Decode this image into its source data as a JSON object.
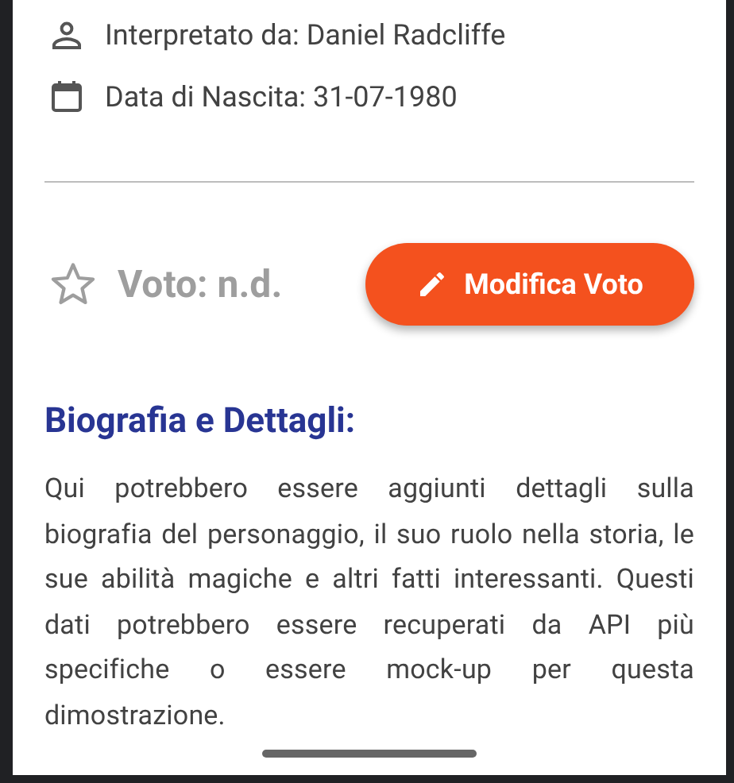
{
  "info_rows": [
    {
      "kind": "person",
      "text": "Interpretato da: Daniel Radcliffe"
    },
    {
      "kind": "calendar",
      "text": "Data di Nascita: 31-07-1980"
    }
  ],
  "rating": {
    "rated": false,
    "label": "Voto: n.d."
  },
  "edit_button": {
    "label": "Modifica Voto"
  },
  "biography": {
    "heading": "Biografia e Dettagli:",
    "text": "Qui potrebbero essere aggiunti dettagli sulla biografia del personaggio, il suo ruolo nella storia, le sue abilità magiche e altri fatti interessanti. Questi dati potrebbero essere recuperati da API più specifiche o essere mock-up per questa dimostrazione."
  }
}
